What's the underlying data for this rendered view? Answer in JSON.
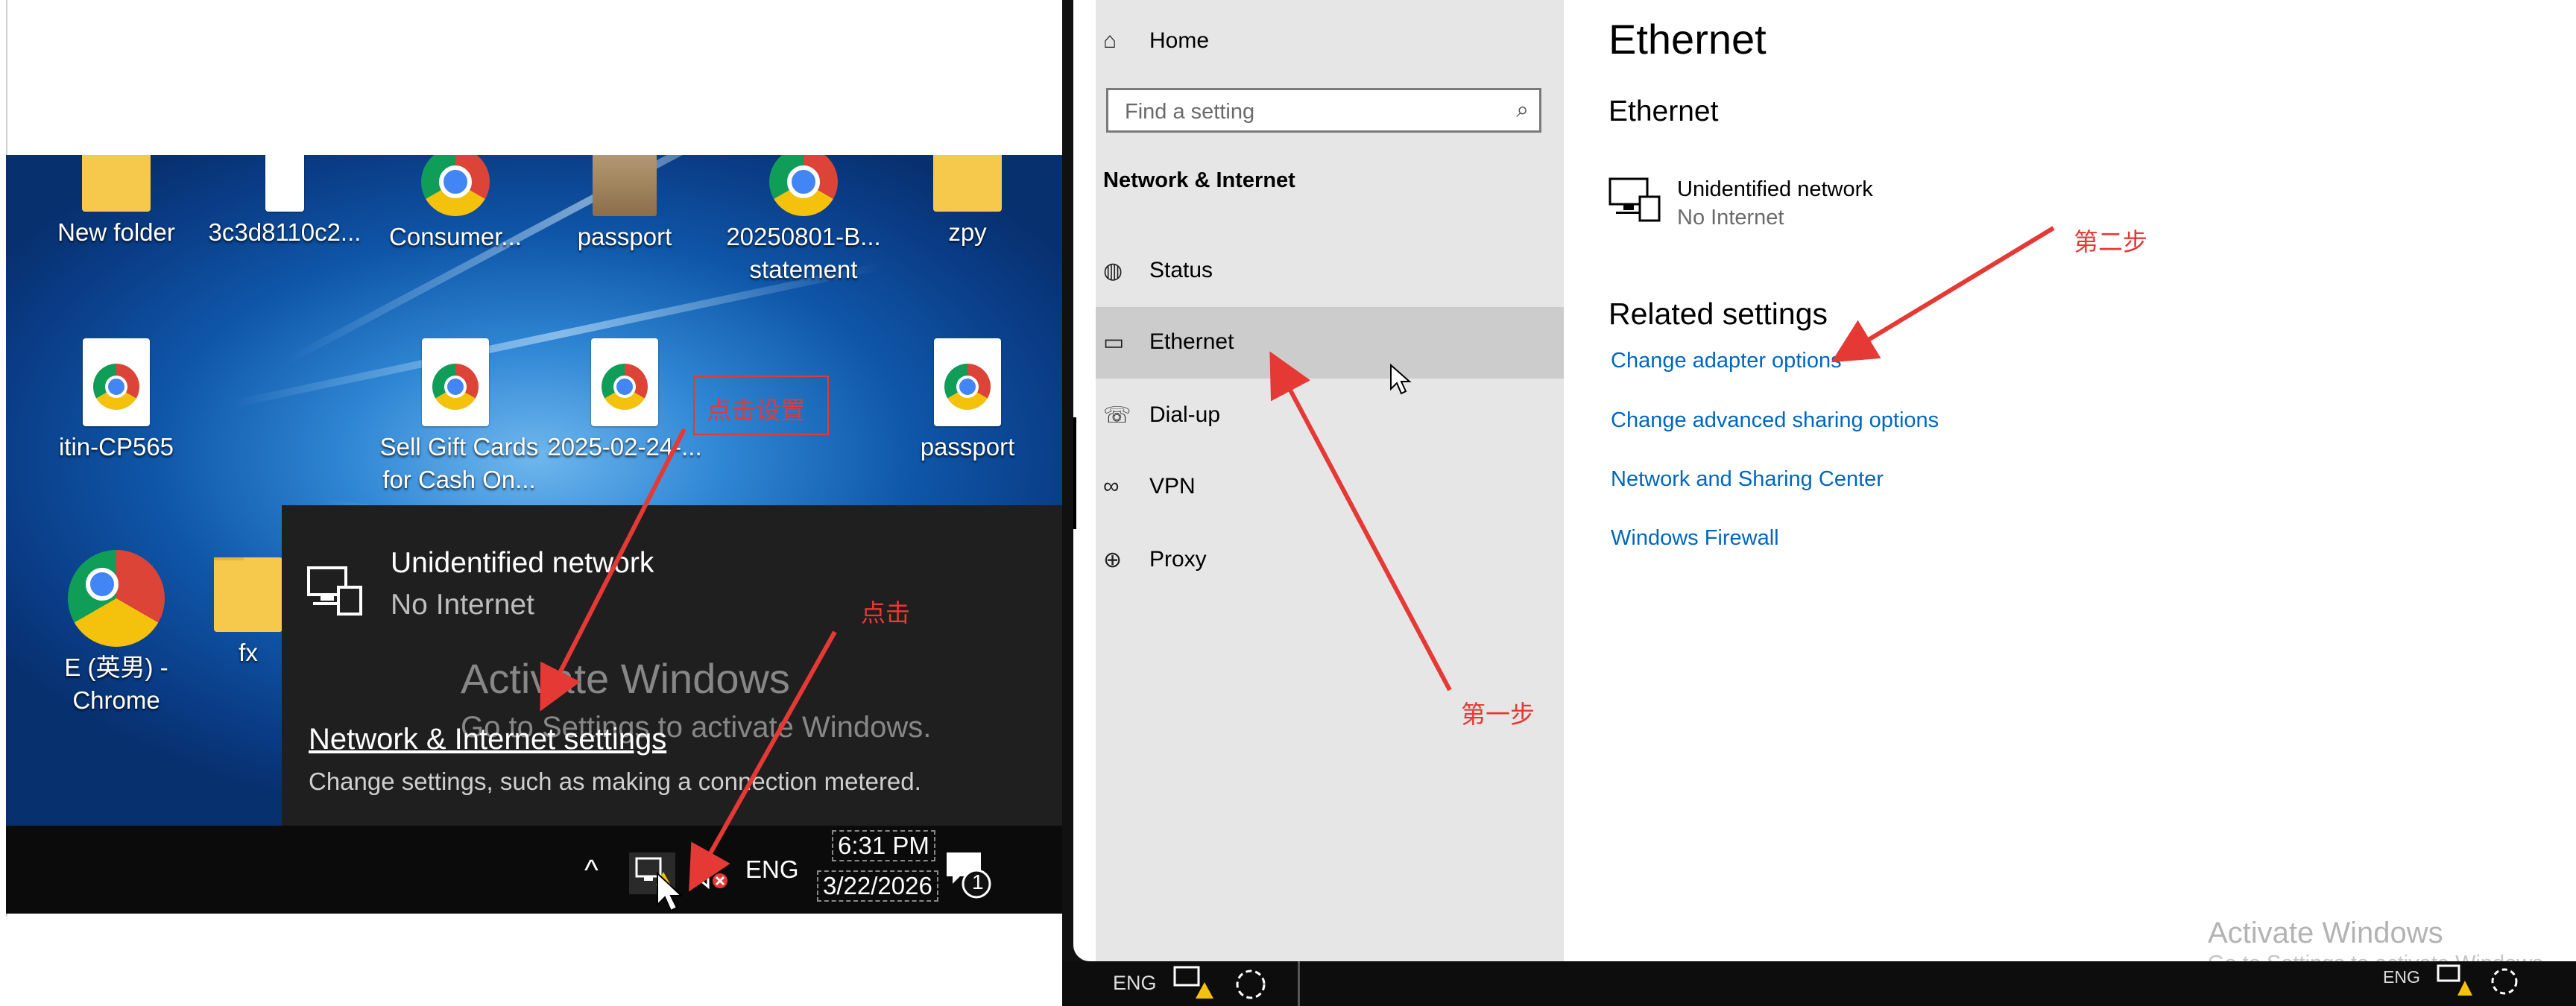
{
  "left": {
    "desktop_icons": [
      {
        "label": "New folder",
        "type": "folder"
      },
      {
        "label": "3c3d8110c2...",
        "type": "doc"
      },
      {
        "label": "Consumer...",
        "type": "chrome"
      },
      {
        "label": "passport",
        "type": "image"
      },
      {
        "label": "20250801-B... statement",
        "type": "chrome"
      },
      {
        "label": "zpy",
        "type": "folder"
      },
      {
        "label": "itin-CP565",
        "type": "chrome-doc"
      },
      {
        "label": "Sell Gift Cards for Cash On...",
        "type": "chrome-doc"
      },
      {
        "label": "2025-02-24-...",
        "type": "chrome-doc"
      },
      {
        "label": "passport",
        "type": "chrome-doc"
      },
      {
        "label": "E (英男) - Chrome",
        "type": "chrome"
      },
      {
        "label": "fx",
        "type": "folder"
      }
    ],
    "flyout": {
      "network_name": "Unidentified network",
      "network_status": "No Internet",
      "settings_link": "Network & Internet settings",
      "settings_desc": "Change settings, such as making a connection metered."
    },
    "watermark": {
      "title": "Activate Windows",
      "subtitle": "Go to Settings to activate Windows."
    },
    "taskbar": {
      "lang": "ENG",
      "time": "6:31 PM",
      "date": "3/22/2026",
      "notification_count": "1"
    },
    "annotations": {
      "click_settings": "点击设置",
      "click": "点击"
    }
  },
  "right": {
    "nav": {
      "home": "Home",
      "search_placeholder": "Find a setting",
      "section_title": "Network & Internet",
      "items": [
        {
          "label": "Status",
          "icon": "globe-status-icon"
        },
        {
          "label": "Ethernet",
          "icon": "ethernet-icon"
        },
        {
          "label": "Dial-up",
          "icon": "dialup-icon"
        },
        {
          "label": "VPN",
          "icon": "vpn-icon"
        },
        {
          "label": "Proxy",
          "icon": "proxy-globe-icon"
        }
      ],
      "selected": "Ethernet"
    },
    "content": {
      "page_title": "Ethernet",
      "subtitle": "Ethernet",
      "network_name": "Unidentified network",
      "network_status": "No Internet",
      "related_title": "Related settings",
      "links": [
        "Change adapter options",
        "Change advanced sharing options",
        "Network and Sharing Center",
        "Windows Firewall"
      ]
    },
    "watermark": {
      "title": "Activate Windows",
      "subtitle": "Go to Settings to activate Windows."
    },
    "taskbar": {
      "lang_left": "ENG",
      "lang_right": "ENG"
    },
    "annotations": {
      "step_one": "第一步",
      "step_two": "第二步"
    }
  },
  "colors": {
    "annotation_red": "#e53935",
    "link_blue": "#0067c0",
    "nav_bg": "#e6e6e6",
    "selected_bg": "#cccccc"
  }
}
